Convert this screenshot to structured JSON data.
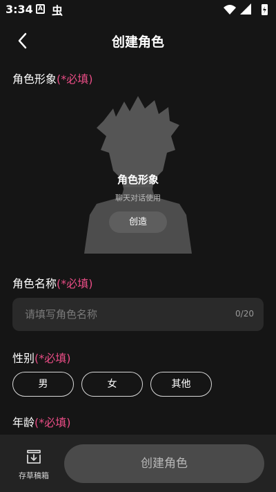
{
  "status_bar": {
    "time": "3:34",
    "notif_a": "A",
    "notif_bug": "虫"
  },
  "header": {
    "title": "创建角色"
  },
  "avatar_section": {
    "label": "角色形象",
    "required": "(*必填)",
    "card_title": "角色形象",
    "card_subtitle": "聊天对话使用",
    "create_button": "创造"
  },
  "name_section": {
    "label": "角色名称",
    "required": "(*必填)",
    "placeholder": "请填写角色名称",
    "value": "",
    "counter": "0/20"
  },
  "gender_section": {
    "label": "性别",
    "required": "(*必填)",
    "options": [
      "男",
      "女",
      "其他"
    ]
  },
  "age_section": {
    "label": "年龄",
    "required": "(*必填)"
  },
  "bottom_bar": {
    "draft_label": "存草稿箱",
    "create_button": "创建角色"
  },
  "colors": {
    "background": "#151515",
    "required": "#ea4d86",
    "input_bg": "#2a2a2a",
    "bottom_bar": "#232323"
  }
}
